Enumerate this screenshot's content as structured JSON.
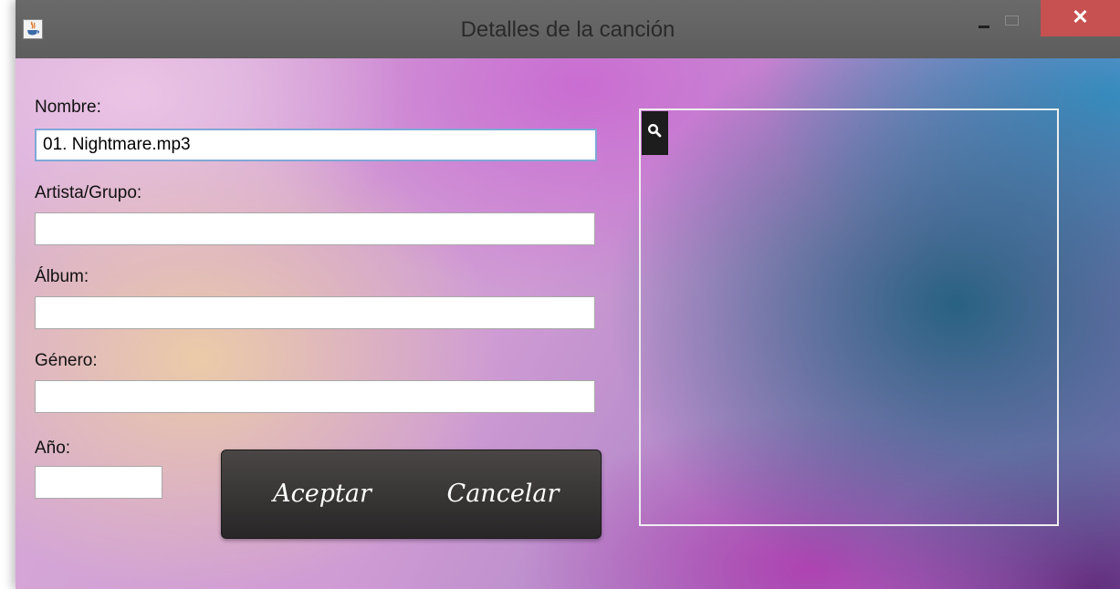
{
  "window": {
    "title": "Detalles de la canción",
    "close_glyph": "✕",
    "icons": {
      "app": "java-cup-icon",
      "minimize": "minimize-icon",
      "maximize": "maximize-icon",
      "close": "close-icon"
    }
  },
  "form": {
    "nombre_label": "Nombre:",
    "nombre_value": "01. Nightmare.mp3",
    "artista_label": "Artista/Grupo:",
    "artista_value": "",
    "album_label": "Álbum:",
    "album_value": "",
    "genero_label": "Género:",
    "genero_value": "",
    "anio_label": "Año:",
    "anio_value": ""
  },
  "buttons": {
    "accept_label": "Aceptar",
    "cancel_label": "Cancelar"
  },
  "artwork": {
    "search_icon": "search-icon"
  },
  "colors": {
    "titlebar": "#626262",
    "close_button": "#c75050",
    "button_panel": "#333030",
    "focus_border": "#7ea8d6"
  }
}
